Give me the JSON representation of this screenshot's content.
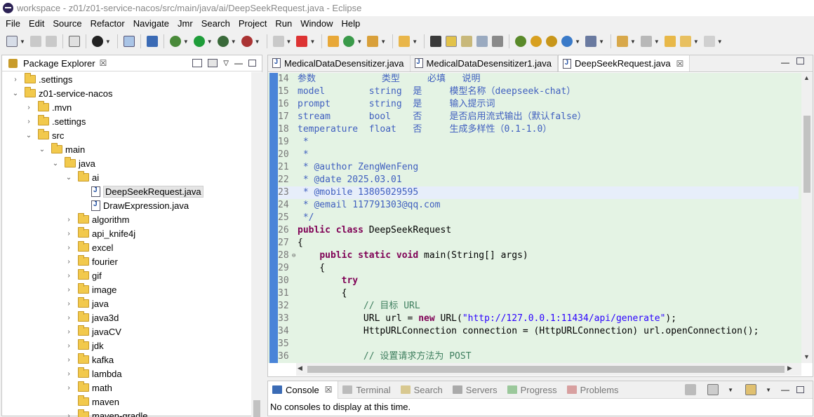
{
  "window": {
    "title": "workspace - z01/z01-service-nacos/src/main/java/ai/DeepSeekRequest.java - Eclipse"
  },
  "menu": [
    "File",
    "Edit",
    "Source",
    "Refactor",
    "Navigate",
    "Jmr",
    "Search",
    "Project",
    "Run",
    "Window",
    "Help"
  ],
  "package_explorer": {
    "title": "Package Explorer",
    "close": "☒",
    "tree": [
      {
        "label": ".settings",
        "indent": 1,
        "twisty": "›",
        "icon": "folder"
      },
      {
        "label": "z01-service-nacos",
        "indent": 1,
        "twisty": "⌄",
        "icon": "folder"
      },
      {
        "label": ".mvn",
        "indent": 2,
        "twisty": "›",
        "icon": "folder"
      },
      {
        "label": ".settings",
        "indent": 2,
        "twisty": "›",
        "icon": "folder"
      },
      {
        "label": "src",
        "indent": 2,
        "twisty": "⌄",
        "icon": "folder"
      },
      {
        "label": "main",
        "indent": 3,
        "twisty": "⌄",
        "icon": "folder"
      },
      {
        "label": "java",
        "indent": 4,
        "twisty": "⌄",
        "icon": "folder"
      },
      {
        "label": "ai",
        "indent": 5,
        "twisty": "⌄",
        "icon": "folder"
      },
      {
        "label": "DeepSeekRequest.java",
        "indent": 6,
        "twisty": "",
        "icon": "file",
        "selected": true
      },
      {
        "label": "DrawExpression.java",
        "indent": 6,
        "twisty": "",
        "icon": "file"
      },
      {
        "label": "algorithm",
        "indent": 5,
        "twisty": "›",
        "icon": "folder"
      },
      {
        "label": "api_knife4j",
        "indent": 5,
        "twisty": "›",
        "icon": "folder"
      },
      {
        "label": "excel",
        "indent": 5,
        "twisty": "›",
        "icon": "folder"
      },
      {
        "label": "fourier",
        "indent": 5,
        "twisty": "›",
        "icon": "folder"
      },
      {
        "label": "gif",
        "indent": 5,
        "twisty": "›",
        "icon": "folder"
      },
      {
        "label": "image",
        "indent": 5,
        "twisty": "›",
        "icon": "folder"
      },
      {
        "label": "java",
        "indent": 5,
        "twisty": "›",
        "icon": "folder"
      },
      {
        "label": "java3d",
        "indent": 5,
        "twisty": "›",
        "icon": "folder"
      },
      {
        "label": "javaCV",
        "indent": 5,
        "twisty": "›",
        "icon": "folder"
      },
      {
        "label": "jdk",
        "indent": 5,
        "twisty": "›",
        "icon": "folder"
      },
      {
        "label": "kafka",
        "indent": 5,
        "twisty": "›",
        "icon": "folder"
      },
      {
        "label": "lambda",
        "indent": 5,
        "twisty": "›",
        "icon": "folder"
      },
      {
        "label": "math",
        "indent": 5,
        "twisty": "›",
        "icon": "folder"
      },
      {
        "label": "maven",
        "indent": 5,
        "twisty": "",
        "icon": "folder"
      },
      {
        "label": "maven-gradle",
        "indent": 5,
        "twisty": "›",
        "icon": "folder"
      }
    ]
  },
  "editor": {
    "tabs": [
      {
        "label": "MedicalDataDesensitizer.java",
        "active": false
      },
      {
        "label": "MedicalDataDesensitizer1.java",
        "active": false
      },
      {
        "label": "DeepSeekRequest.java",
        "active": true
      }
    ],
    "close": "☒",
    "lines": [
      {
        "n": "14",
        "segs": [
          [
            "jd",
            "参数            类型     必填   说明"
          ]
        ]
      },
      {
        "n": "15",
        "segs": [
          [
            "jd",
            "model        string  是     模型名称（deepseek-chat）"
          ]
        ]
      },
      {
        "n": "16",
        "segs": [
          [
            "jd",
            "prompt       string  是     输入提示词"
          ]
        ]
      },
      {
        "n": "17",
        "segs": [
          [
            "jd",
            "stream       bool    否     是否启用流式输出（默认false）"
          ]
        ]
      },
      {
        "n": "18",
        "segs": [
          [
            "jd",
            "temperature  float   否     生成多样性（0.1-1.0）"
          ]
        ]
      },
      {
        "n": "19",
        "segs": [
          [
            "jd",
            " *"
          ]
        ]
      },
      {
        "n": "20",
        "segs": [
          [
            "jd",
            " *"
          ]
        ]
      },
      {
        "n": "21",
        "segs": [
          [
            "jd",
            " * @author ZengWenFeng"
          ]
        ]
      },
      {
        "n": "22",
        "segs": [
          [
            "jd",
            " * @date 2025.03.01"
          ]
        ]
      },
      {
        "n": "23",
        "segs": [
          [
            "jd",
            " * @mobile 13805029595"
          ]
        ],
        "hl": true
      },
      {
        "n": "24",
        "segs": [
          [
            "jd",
            " * @email 117791303@qq.com"
          ]
        ]
      },
      {
        "n": "25",
        "segs": [
          [
            "jd",
            " */"
          ]
        ]
      },
      {
        "n": "26",
        "segs": [
          [
            "kw",
            "public class"
          ],
          [
            "",
            " DeepSeekRequest"
          ]
        ]
      },
      {
        "n": "27",
        "segs": [
          [
            "",
            "{"
          ]
        ]
      },
      {
        "n": "28",
        "segs": [
          [
            "",
            "    "
          ],
          [
            "kw",
            "public static void"
          ],
          [
            "",
            " main(String[] args)"
          ]
        ],
        "fold": true
      },
      {
        "n": "29",
        "segs": [
          [
            "",
            "    {"
          ]
        ]
      },
      {
        "n": "30",
        "segs": [
          [
            "",
            "        "
          ],
          [
            "kw",
            "try"
          ]
        ]
      },
      {
        "n": "31",
        "segs": [
          [
            "",
            "        {"
          ]
        ]
      },
      {
        "n": "32",
        "segs": [
          [
            "",
            "            "
          ],
          [
            "cm",
            "// 目标 URL"
          ]
        ]
      },
      {
        "n": "33",
        "segs": [
          [
            "",
            "            URL url = "
          ],
          [
            "kw",
            "new"
          ],
          [
            "",
            " URL("
          ],
          [
            "str",
            "\"http://127.0.0.1:11434/api/generate\""
          ],
          [
            "",
            ");"
          ]
        ]
      },
      {
        "n": "34",
        "segs": [
          [
            "",
            "            HttpURLConnection connection = (HttpURLConnection) url.openConnection();"
          ]
        ]
      },
      {
        "n": "35",
        "segs": [
          [
            "",
            ""
          ]
        ]
      },
      {
        "n": "36",
        "segs": [
          [
            "",
            "            "
          ],
          [
            "cm",
            "// 设置请求方法为 POST"
          ]
        ]
      }
    ]
  },
  "console": {
    "tabs": [
      "Console",
      "Terminal",
      "Search",
      "Servers",
      "Progress",
      "Problems"
    ],
    "close": "☒",
    "message": "No consoles to display at this time."
  },
  "colors": {
    "code_bg": "#e4f3e4",
    "keyword": "#7f0055",
    "javadoc": "#3f5fbf",
    "comment": "#3f7f5f",
    "string": "#2a00ff"
  }
}
